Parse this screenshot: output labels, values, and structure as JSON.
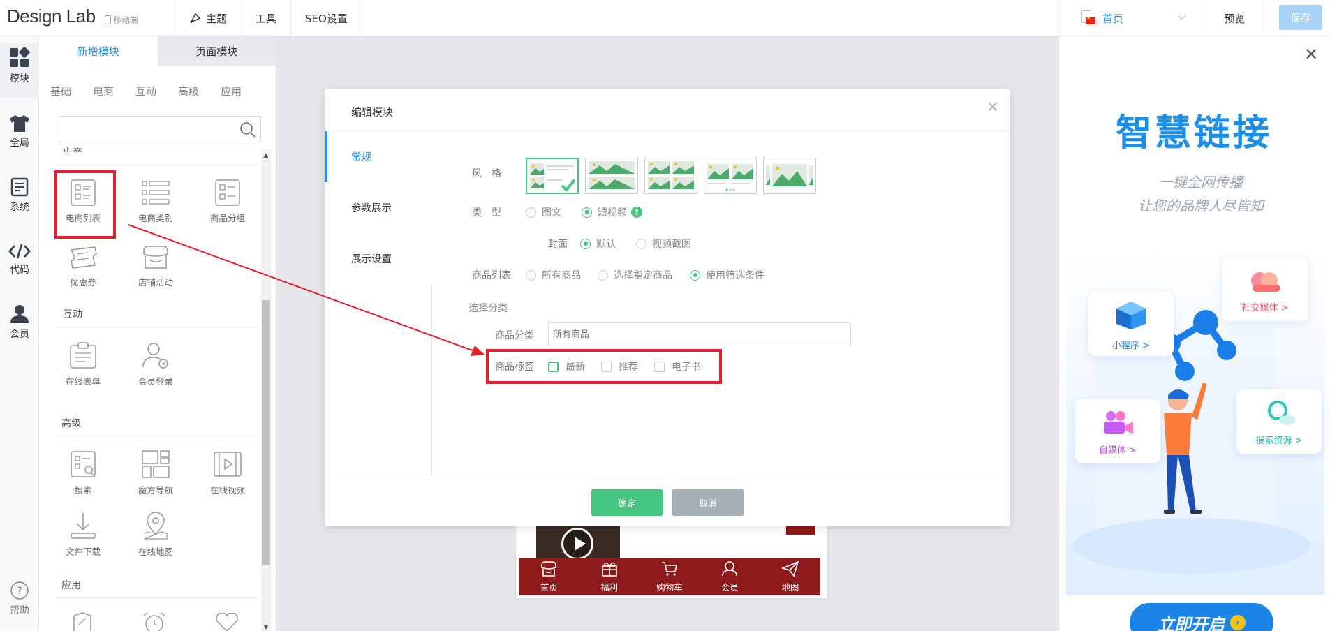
{
  "app": {
    "logo": "Design Lab",
    "mobile_label": "移动端",
    "nav": [
      "主题",
      "工具",
      "SEO设置"
    ],
    "page_selected": "首页",
    "preview": "预览",
    "save": "保存"
  },
  "rail": {
    "items": [
      {
        "label": "模块",
        "icon": "blocks-icon"
      },
      {
        "label": "全局",
        "icon": "shirt-icon"
      },
      {
        "label": "系统",
        "icon": "document-icon"
      },
      {
        "label": "代码",
        "icon": "code-icon"
      },
      {
        "label": "会员",
        "icon": "user-icon"
      }
    ],
    "help": "帮助"
  },
  "panel": {
    "tabs": [
      "新增模块",
      "页面模块"
    ],
    "subtabs": [
      "基础",
      "电商",
      "互动",
      "高级",
      "应用"
    ],
    "search_placeholder": "",
    "sections": {
      "ecommerce": "电商",
      "interaction": "互动",
      "advanced": "高级",
      "apps": "应用"
    },
    "modules": {
      "ecom_list": "电商列表",
      "ecom_category": "电商类别",
      "product_group": "商品分组",
      "coupon": "优惠券",
      "store_activity": "店铺活动",
      "online_form": "在线表单",
      "member_login": "会员登录",
      "search": "搜索",
      "magic_nav": "魔方导航",
      "online_video": "在线视频",
      "file_download": "文件下载",
      "online_map": "在线地图"
    }
  },
  "canvas": {
    "bottom_nav": [
      "首页",
      "福利",
      "购物车",
      "会员",
      "地图"
    ]
  },
  "ad": {
    "title": "智慧链接",
    "subtitle_1": "一键全网传播",
    "subtitle_2": "让您的品牌人尽皆知",
    "cards": {
      "mini_program": "小程序 >",
      "social_media": "社交媒体 >",
      "self_media": "自媒体 >",
      "search_resources": "搜索资源 >"
    },
    "cta": "立即开启"
  },
  "modal": {
    "title": "编辑模块",
    "tabs": [
      "常规",
      "参数展示",
      "展示设置"
    ],
    "fields": {
      "style_label": "风　格",
      "type_label": "类　型",
      "type_options": [
        "图文",
        "短视频"
      ],
      "type_selected": "短视频",
      "cover_label": "封面",
      "cover_options": [
        "默认",
        "视频截图"
      ],
      "cover_selected": "默认",
      "product_list_label": "商品列表",
      "product_list_options": [
        "所有商品",
        "选择指定商品",
        "使用筛选条件"
      ],
      "product_list_selected": "使用筛选条件",
      "select_category_heading": "选择分类",
      "product_category_label": "商品分类",
      "product_category_placeholder": "所有商品",
      "product_tag_label": "商品标签",
      "product_tags": [
        "最新",
        "推荐",
        "电子书"
      ]
    },
    "ok": "确定",
    "cancel": "取消"
  },
  "colors": {
    "accent_blue": "#2a8ed8",
    "green": "#45c681",
    "highlight_red": "#e0202b",
    "nav_red": "#8e1b1b"
  }
}
